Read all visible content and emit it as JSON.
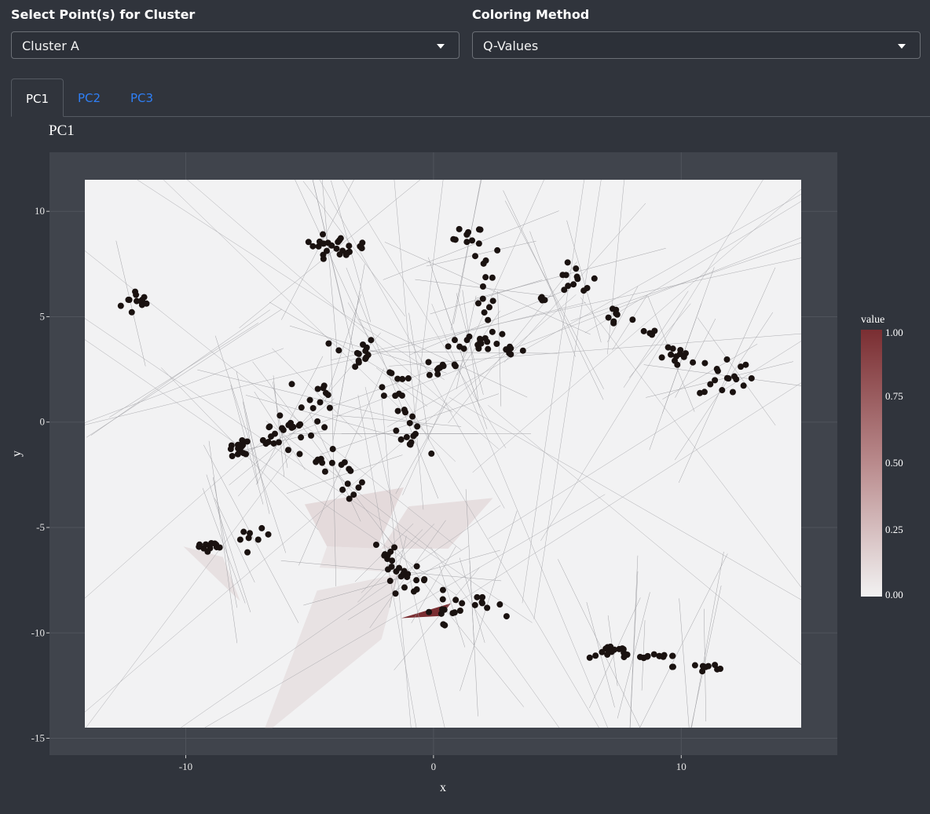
{
  "controls": {
    "cluster_label": "Select Point(s) for Cluster",
    "cluster_value": "Cluster A",
    "method_label": "Coloring Method",
    "method_value": "Q-Values"
  },
  "tabs": [
    {
      "label": "PC1",
      "active": true
    },
    {
      "label": "PC2",
      "active": false
    },
    {
      "label": "PC3",
      "active": false
    }
  ],
  "icons": {
    "dropdown": "chevron-down-icon"
  },
  "colors": {
    "background": "#30343c",
    "panel": "#40444c",
    "link": "#2f7ff5",
    "point": "#1a1210",
    "scale_high": "#7a2e32",
    "scale_low": "#f2f2f2"
  },
  "chart_data": {
    "type": "scatter",
    "title": "PC1",
    "xlabel": "x",
    "ylabel": "y",
    "xlim": [
      -15.5,
      16.3
    ],
    "ylim": [
      -15.8,
      12.8
    ],
    "xticks": [
      -10,
      0,
      10
    ],
    "yticks": [
      10,
      5,
      0,
      -5,
      -10,
      -15
    ],
    "legend": {
      "title": "value",
      "ticks": [
        "1.00",
        "0.75",
        "0.50",
        "0.25",
        "0.00"
      ],
      "position": "right"
    },
    "grid": true,
    "clusters": [
      {
        "cx": -11.9,
        "cy": 5.7,
        "sx": 0.35,
        "sy": 0.35,
        "n": 12
      },
      {
        "cx": -4.3,
        "cy": 8.4,
        "sx": 0.45,
        "sy": 0.25,
        "n": 16
      },
      {
        "cx": -3.1,
        "cy": 8.2,
        "sx": 0.35,
        "sy": 0.2,
        "n": 8
      },
      {
        "cx": 1.4,
        "cy": 8.7,
        "sx": 0.3,
        "sy": 0.3,
        "n": 10
      },
      {
        "cx": 2.2,
        "cy": 6.5,
        "sx": 0.25,
        "sy": 1.1,
        "n": 14
      },
      {
        "cx": 4.2,
        "cy": 5.8,
        "sx": 0.2,
        "sy": 0.1,
        "n": 4
      },
      {
        "cx": 5.7,
        "cy": 6.7,
        "sx": 0.45,
        "sy": 0.35,
        "n": 12
      },
      {
        "cx": 7.4,
        "cy": 5.0,
        "sx": 0.3,
        "sy": 0.25,
        "n": 8
      },
      {
        "cx": 8.4,
        "cy": 4.2,
        "sx": 0.35,
        "sy": 0.15,
        "n": 5
      },
      {
        "cx": 10.0,
        "cy": 3.0,
        "sx": 0.45,
        "sy": 0.25,
        "n": 12
      },
      {
        "cx": 11.8,
        "cy": 2.2,
        "sx": 0.55,
        "sy": 0.55,
        "n": 18
      },
      {
        "cx": -3.2,
        "cy": 3.3,
        "sx": 0.45,
        "sy": 0.4,
        "n": 14
      },
      {
        "cx": -1.6,
        "cy": 1.8,
        "sx": 0.45,
        "sy": 0.5,
        "n": 10
      },
      {
        "cx": 0.3,
        "cy": 2.6,
        "sx": 0.5,
        "sy": 0.3,
        "n": 10
      },
      {
        "cx": 1.9,
        "cy": 3.8,
        "sx": 0.6,
        "sy": 0.25,
        "n": 16
      },
      {
        "cx": 3.1,
        "cy": 3.4,
        "sx": 0.3,
        "sy": 0.2,
        "n": 6
      },
      {
        "cx": -4.5,
        "cy": 1.4,
        "sx": 0.35,
        "sy": 0.35,
        "n": 10
      },
      {
        "cx": -1.3,
        "cy": 0.4,
        "sx": 0.2,
        "sy": 0.35,
        "n": 6
      },
      {
        "cx": -0.9,
        "cy": -0.9,
        "sx": 0.3,
        "sy": 0.3,
        "n": 9
      },
      {
        "cx": -5.3,
        "cy": -0.1,
        "sx": 0.5,
        "sy": 0.35,
        "n": 10
      },
      {
        "cx": -6.6,
        "cy": -0.6,
        "sx": 0.45,
        "sy": 0.45,
        "n": 14
      },
      {
        "cx": -7.8,
        "cy": -1.3,
        "sx": 0.45,
        "sy": 0.25,
        "n": 14
      },
      {
        "cx": -4.1,
        "cy": -1.6,
        "sx": 0.45,
        "sy": 0.35,
        "n": 10
      },
      {
        "cx": -3.3,
        "cy": -3.0,
        "sx": 0.25,
        "sy": 0.45,
        "n": 8
      },
      {
        "cx": -7.2,
        "cy": -5.5,
        "sx": 0.3,
        "sy": 0.2,
        "n": 8
      },
      {
        "cx": -9.1,
        "cy": -5.9,
        "sx": 0.35,
        "sy": 0.2,
        "n": 12
      },
      {
        "cx": -1.7,
        "cy": -6.2,
        "sx": 0.35,
        "sy": 0.3,
        "n": 10
      },
      {
        "cx": -1.1,
        "cy": -7.5,
        "sx": 0.45,
        "sy": 0.3,
        "n": 16
      },
      {
        "cx": 0.3,
        "cy": -8.9,
        "sx": 0.3,
        "sy": 0.4,
        "n": 9
      },
      {
        "cx": 1.6,
        "cy": -8.7,
        "sx": 0.6,
        "sy": 0.2,
        "n": 12
      },
      {
        "cx": 7.2,
        "cy": -10.9,
        "sx": 0.45,
        "sy": 0.15,
        "n": 14
      },
      {
        "cx": 8.8,
        "cy": -11.1,
        "sx": 0.7,
        "sy": 0.08,
        "n": 14
      },
      {
        "cx": 10.9,
        "cy": -11.6,
        "sx": 0.6,
        "sy": 0.2,
        "n": 10
      }
    ],
    "regions": [
      {
        "points": [
          [
            -1.3,
            -9.3
          ],
          [
            0.7,
            -8.6
          ],
          [
            0.3,
            -9.2
          ]
        ],
        "value": 1.0
      },
      {
        "points": [
          [
            -5.2,
            -3.9
          ],
          [
            -1.2,
            -3.1
          ],
          [
            -2.3,
            -6.0
          ],
          [
            -4.3,
            -5.9
          ]
        ],
        "value": 0.12
      },
      {
        "points": [
          [
            -2.1,
            -6.0
          ],
          [
            -1.0,
            -4.0
          ],
          [
            2.4,
            -3.6
          ],
          [
            0.6,
            -6.0
          ]
        ],
        "value": 0.1
      },
      {
        "points": [
          [
            -6.8,
            -14.5
          ],
          [
            -4.7,
            -8.0
          ],
          [
            -1.4,
            -7.2
          ],
          [
            -2.1,
            -10.3
          ],
          [
            -6.5,
            -14.5
          ]
        ],
        "value": 0.08
      },
      {
        "points": [
          [
            -10.1,
            -5.9
          ],
          [
            -8.5,
            -6.4
          ],
          [
            -7.8,
            -8.5
          ]
        ],
        "value": 0.09
      },
      {
        "points": [
          [
            -4.3,
            -5.9
          ],
          [
            -2.1,
            -6.0
          ],
          [
            -1.8,
            -7.1
          ],
          [
            -4.6,
            -6.9
          ]
        ],
        "value": 0.07
      }
    ]
  }
}
